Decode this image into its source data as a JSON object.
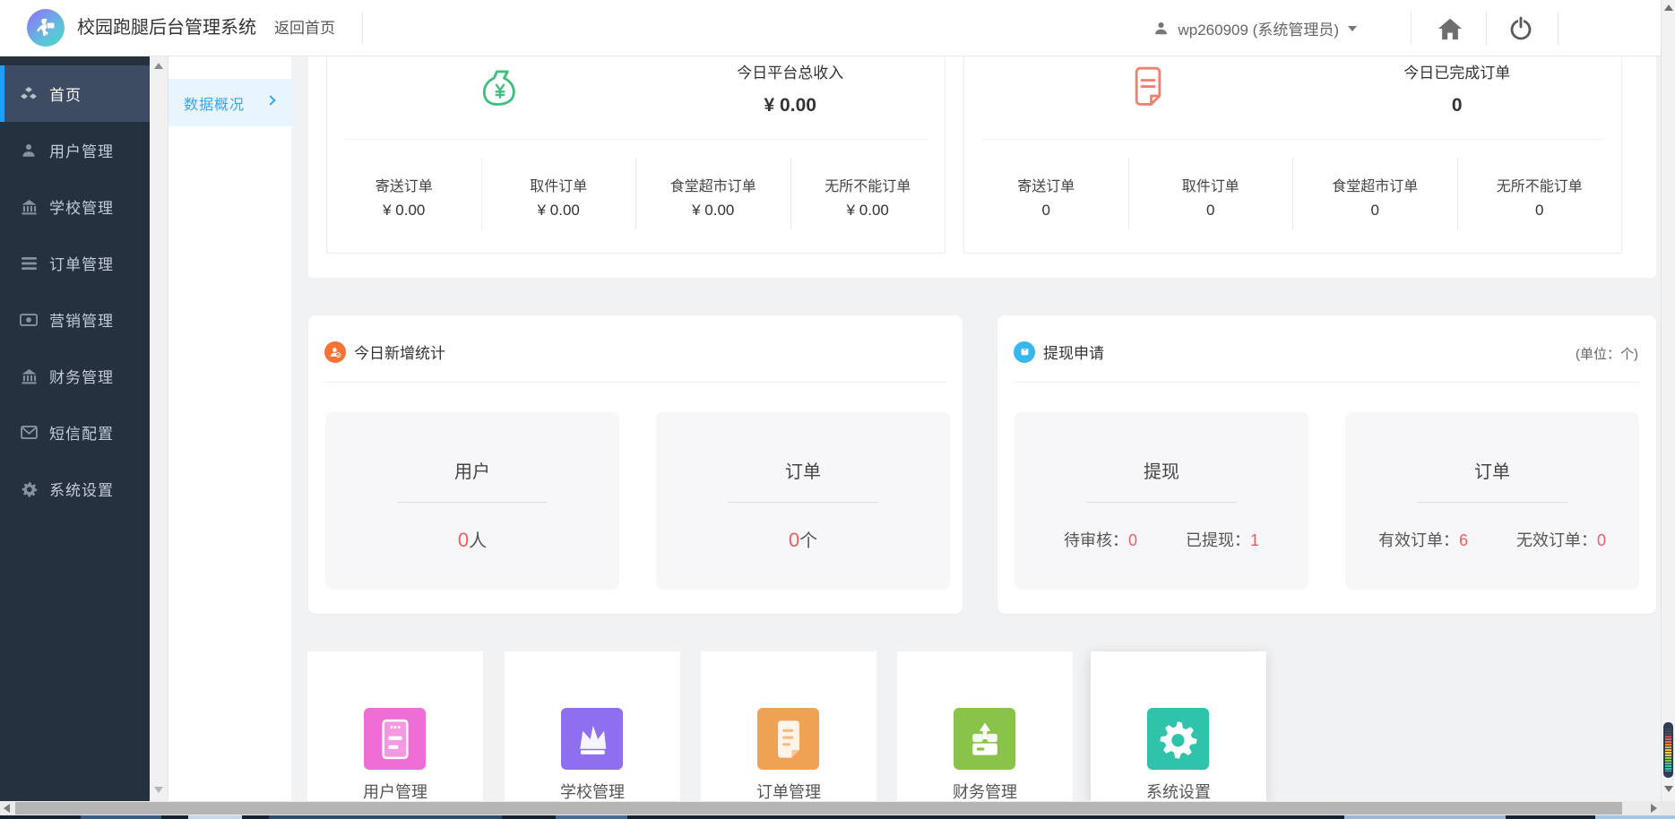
{
  "topbar": {
    "brand": "校园跑腿后台管理系统",
    "back_home": "返回首页",
    "username": "wp260909 (系统管理员)"
  },
  "sidebar": {
    "items": [
      {
        "label": "首页",
        "icon": "cubes-icon",
        "active": true
      },
      {
        "label": "用户管理",
        "icon": "user-icon",
        "active": false
      },
      {
        "label": "学校管理",
        "icon": "bank-icon",
        "active": false
      },
      {
        "label": "订单管理",
        "icon": "list-icon",
        "active": false
      },
      {
        "label": "营销管理",
        "icon": "money-bill-icon",
        "active": false
      },
      {
        "label": "财务管理",
        "icon": "bank-icon",
        "active": false
      },
      {
        "label": "短信配置",
        "icon": "mail-icon",
        "active": false
      },
      {
        "label": "系统设置",
        "icon": "gear-icon",
        "active": false
      }
    ]
  },
  "subnav": {
    "tab_label": "数据概况"
  },
  "revenue_card": {
    "title": "今日平台总收入",
    "value": "¥ 0.00",
    "stats": [
      {
        "label": "寄送订单",
        "value": "¥ 0.00"
      },
      {
        "label": "取件订单",
        "value": "¥ 0.00"
      },
      {
        "label": "食堂超市订单",
        "value": "¥ 0.00"
      },
      {
        "label": "无所不能订单",
        "value": "¥ 0.00"
      }
    ]
  },
  "orders_card": {
    "title": "今日已完成订单",
    "value": "0",
    "stats": [
      {
        "label": "寄送订单",
        "value": "0"
      },
      {
        "label": "取件订单",
        "value": "0"
      },
      {
        "label": "食堂超市订单",
        "value": "0"
      },
      {
        "label": "无所不能订单",
        "value": "0"
      }
    ]
  },
  "today_new_card": {
    "title": "今日新增统计",
    "boxes": [
      {
        "title": "用户",
        "value": "0",
        "unit": "人"
      },
      {
        "title": "订单",
        "value": "0",
        "unit": "个"
      }
    ]
  },
  "withdraw_card": {
    "title": "提现申请",
    "unit_note": "(单位：个)",
    "boxes": [
      {
        "title": "提现",
        "stats": [
          {
            "label": "待审核：",
            "value": "0"
          },
          {
            "label": "已提现：",
            "value": "1"
          }
        ]
      },
      {
        "title": "订单",
        "stats": [
          {
            "label": "有效订单：",
            "value": "6"
          },
          {
            "label": "无效订单：",
            "value": "0"
          }
        ]
      }
    ]
  },
  "shortcuts": {
    "items": [
      {
        "label": "用户管理",
        "icon": "form-icon",
        "color": "#ef6ed5"
      },
      {
        "label": "学校管理",
        "icon": "crown-icon",
        "color": "#8d6ff0"
      },
      {
        "label": "订单管理",
        "icon": "document-icon",
        "color": "#f0a254"
      },
      {
        "label": "财务管理",
        "icon": "deposit-icon",
        "color": "#8ac34a"
      },
      {
        "label": "系统设置",
        "icon": "gear-icon",
        "color": "#2fc3ab"
      }
    ]
  },
  "colors": {
    "accent_blue": "#1e9fff",
    "sidebar_bg": "#263140",
    "sidebar_active_bg": "#3d4c63",
    "tab_bg": "#e9f5fe",
    "tab_text": "#38a3f2",
    "content_bg": "#f1f2f4",
    "danger_red": "#f45b62",
    "revenue_green": "#3fbf7f",
    "orders_coral": "#f08070",
    "new_stat_orange": "#f77234",
    "withdraw_blue": "#38b6f0"
  }
}
